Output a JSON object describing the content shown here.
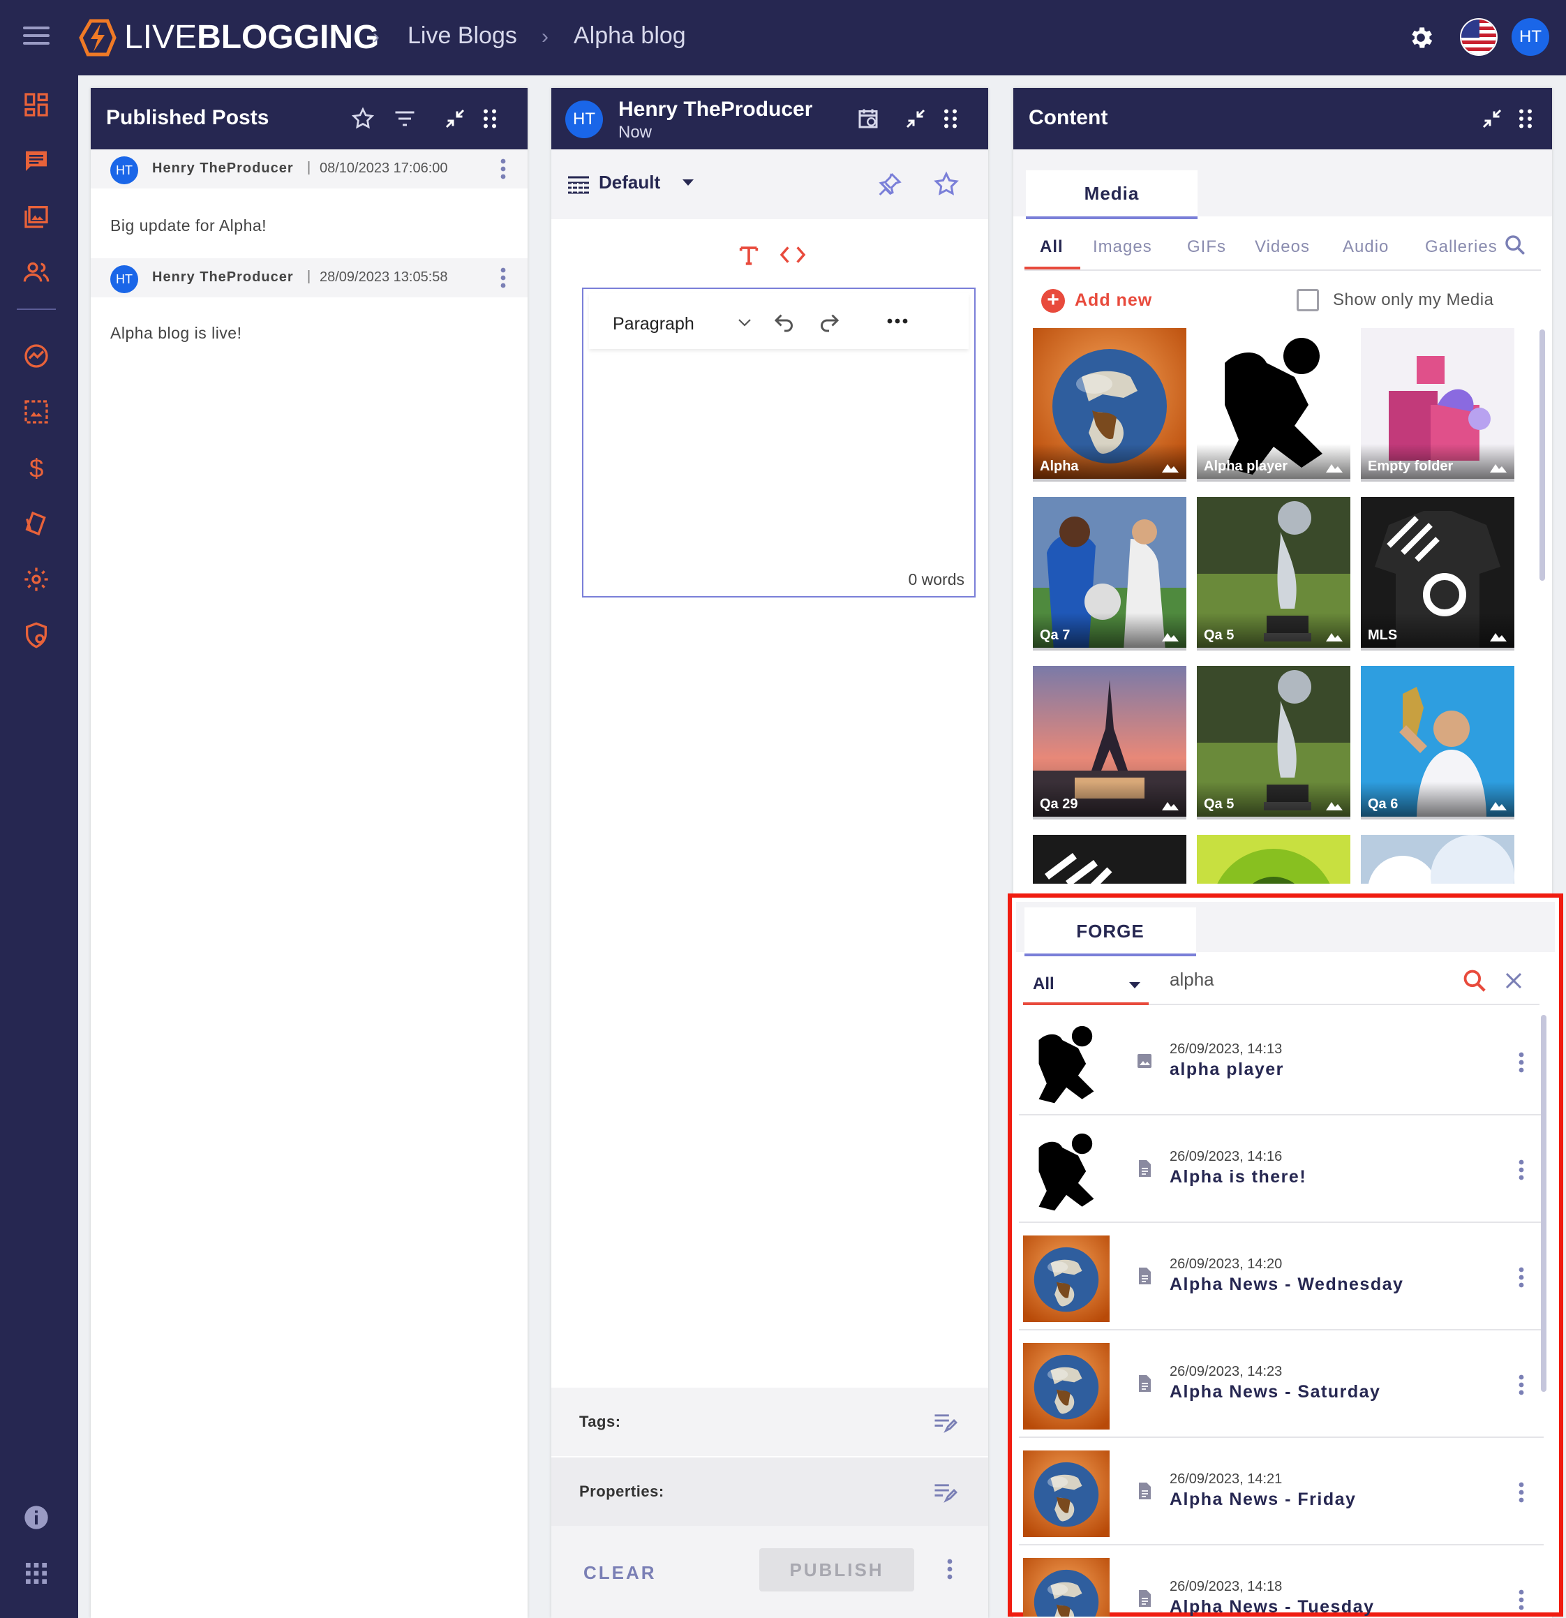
{
  "app": {
    "logo_light": "LIVE",
    "logo_bold": "BLOGGING",
    "breadcrumbs": [
      "Live Blogs",
      "Alpha blog"
    ],
    "user_initials": "HT",
    "accent": "#262751",
    "brand_orange": "#f07a26"
  },
  "sidebar": {
    "icons": [
      "dashboard-icon",
      "posts-icon",
      "media-icon",
      "users-icon",
      "analytics-icon",
      "gallery-icon",
      "dollar-icon",
      "cards-icon",
      "settings-icon",
      "security-icon",
      "info-icon",
      "apps-grid-icon"
    ]
  },
  "published": {
    "title": "Published Posts",
    "posts": [
      {
        "initials": "HT",
        "author": "Henry TheProducer",
        "date": "08/10/2023 17:06:00",
        "body": "Big update for Alpha!"
      },
      {
        "initials": "HT",
        "author": "Henry TheProducer",
        "date": "28/09/2023 13:05:58",
        "body": "Alpha blog is live!"
      }
    ]
  },
  "editor": {
    "initials": "HT",
    "author": "Henry TheProducer",
    "time": "Now",
    "template": "Default",
    "block_type": "Paragraph",
    "word_count": "0 words",
    "tags_label": "Tags:",
    "properties_label": "Properties:",
    "clear_label": "CLEAR",
    "publish_label": "PUBLISH"
  },
  "content": {
    "title": "Content",
    "tab": "Media",
    "subtabs": [
      "All",
      "Images",
      "GIFs",
      "Videos",
      "Audio",
      "Galleries"
    ],
    "add_new": "Add new",
    "show_only_mine": "Show only my Media",
    "media": [
      {
        "label": "Alpha",
        "kind": "globe"
      },
      {
        "label": "Alpha player",
        "kind": "silhouette"
      },
      {
        "label": "Empty folder",
        "kind": "folder"
      },
      {
        "label": "Qa 7",
        "kind": "soccer"
      },
      {
        "label": "Qa 5",
        "kind": "trophy"
      },
      {
        "label": "MLS",
        "kind": "jersey"
      },
      {
        "label": "Qa 29",
        "kind": "paris"
      },
      {
        "label": "Qa 5",
        "kind": "trophy"
      },
      {
        "label": "Qa 6",
        "kind": "player"
      }
    ]
  },
  "forge": {
    "tab": "FORGE",
    "filter": "All",
    "query": "alpha",
    "results": [
      {
        "date": "26/09/2023, 14:13",
        "title": "alpha player",
        "thumb": "silhouette",
        "type": "image-icon"
      },
      {
        "date": "26/09/2023, 14:16",
        "title": "Alpha is there!",
        "thumb": "silhouette",
        "type": "document-icon"
      },
      {
        "date": "26/09/2023, 14:20",
        "title": "Alpha News - Wednesday",
        "thumb": "globe",
        "type": "document-icon"
      },
      {
        "date": "26/09/2023, 14:23",
        "title": "Alpha News - Saturday",
        "thumb": "globe",
        "type": "document-icon"
      },
      {
        "date": "26/09/2023, 14:21",
        "title": "Alpha News - Friday",
        "thumb": "globe",
        "type": "document-icon"
      },
      {
        "date": "26/09/2023, 14:18",
        "title": "Alpha News - Tuesday",
        "thumb": "globe",
        "type": "document-icon"
      }
    ]
  }
}
